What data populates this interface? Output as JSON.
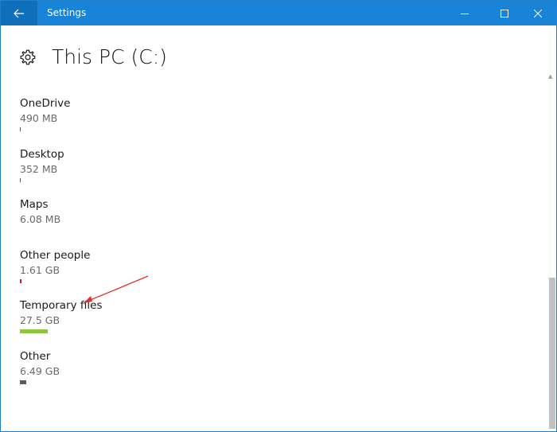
{
  "window": {
    "title": "Settings"
  },
  "page": {
    "title": "This PC (C:)",
    "icon": "gear-icon"
  },
  "items": [
    {
      "name": "OneDrive",
      "size": "490 MB",
      "color": "#2b579a",
      "fill": 0.005
    },
    {
      "name": "Desktop",
      "size": "352 MB",
      "color": "#2b579a",
      "fill": 0.004
    },
    {
      "name": "Maps",
      "size": "6.08 MB",
      "color": "#2b579a",
      "fill": 0
    },
    {
      "name": "Other people",
      "size": "1.61 GB",
      "color": "#e81123",
      "fill": 0.01
    },
    {
      "name": "Temporary files",
      "size": "27.5 GB",
      "color": "#8cc63f",
      "fill": 0.12
    },
    {
      "name": "Other",
      "size": "6.49 GB",
      "color": "#5a5a5a",
      "fill": 0.028
    }
  ],
  "colors": {
    "titlebar": "#1883d7",
    "accent": "#0078d7",
    "annotation_arrow": "#e03030"
  }
}
